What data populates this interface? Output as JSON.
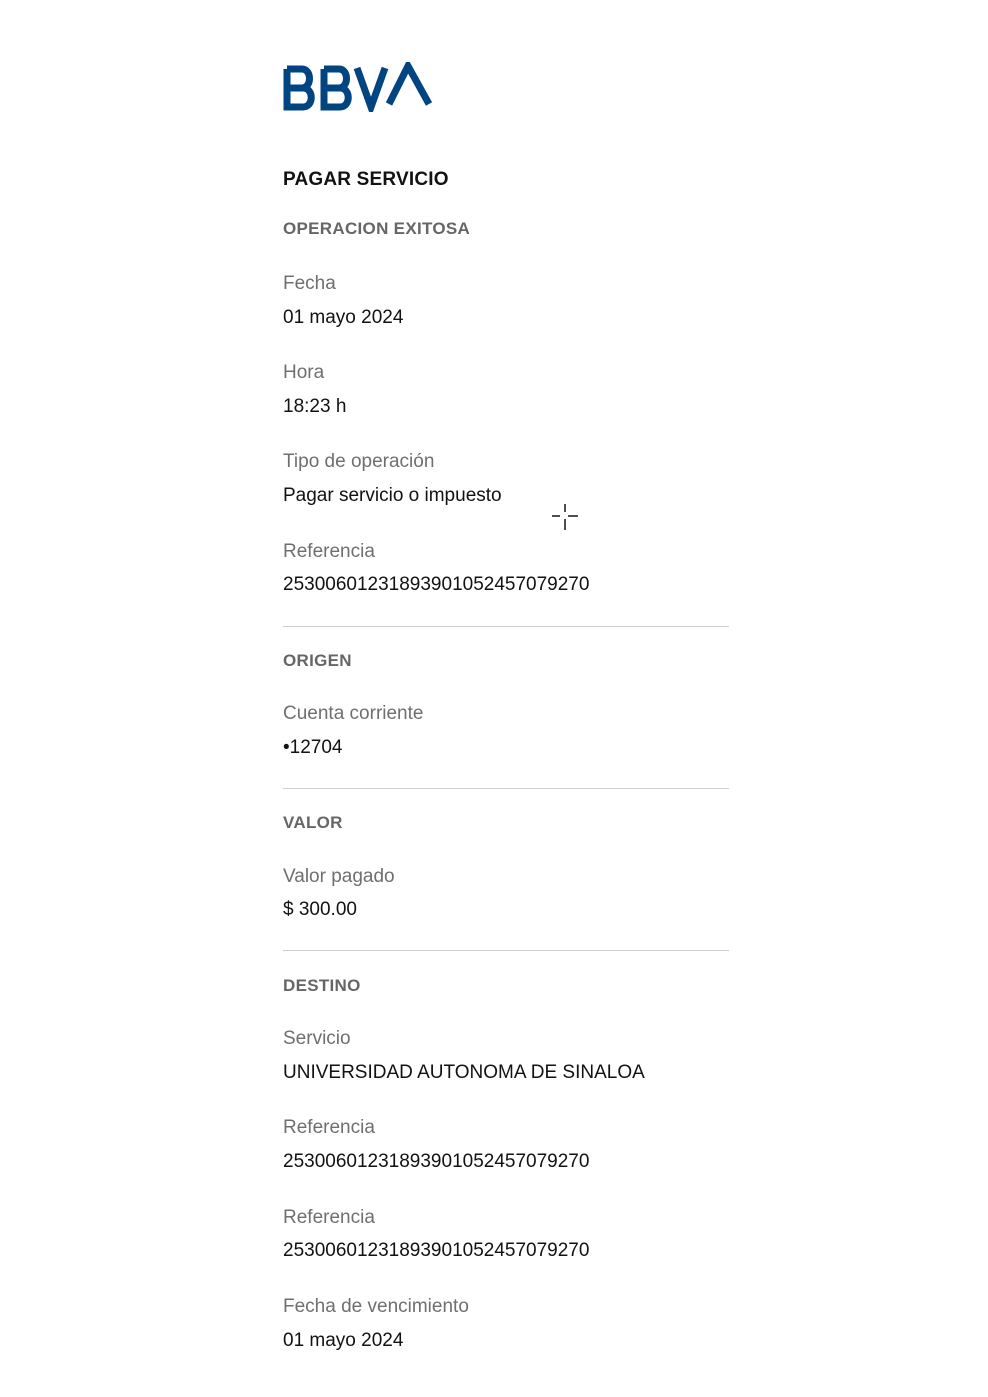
{
  "brand": {
    "name": "BBVA",
    "color": "#004481"
  },
  "title": "PAGAR SERVICIO",
  "status": "OPERACION EXITOSA",
  "details": {
    "fecha": {
      "label": "Fecha",
      "value": "01 mayo 2024"
    },
    "hora": {
      "label": "Hora",
      "value": "18:23 h"
    },
    "tipo": {
      "label": "Tipo de operación",
      "value": "Pagar servicio o impuesto"
    },
    "referencia": {
      "label": "Referencia",
      "value": "25300601231893901052457079270"
    }
  },
  "origen": {
    "section": "ORIGEN",
    "cuenta": {
      "label": "Cuenta corriente",
      "value": "•12704"
    }
  },
  "valor": {
    "section": "VALOR",
    "pagado": {
      "label": "Valor pagado",
      "value": "$ 300.00"
    }
  },
  "destino": {
    "section": "DESTINO",
    "servicio": {
      "label": "Servicio",
      "value": "UNIVERSIDAD AUTONOMA DE SINALOA"
    },
    "referencia1": {
      "label": "Referencia",
      "value": "25300601231893901052457079270"
    },
    "referencia2": {
      "label": "Referencia",
      "value": "25300601231893901052457079270"
    },
    "vencimiento": {
      "label": "Fecha de vencimiento",
      "value": "01 mayo 2024"
    }
  },
  "icons": {
    "logo": "bbva-logo",
    "cursor": "crosshair-cursor-icon"
  }
}
